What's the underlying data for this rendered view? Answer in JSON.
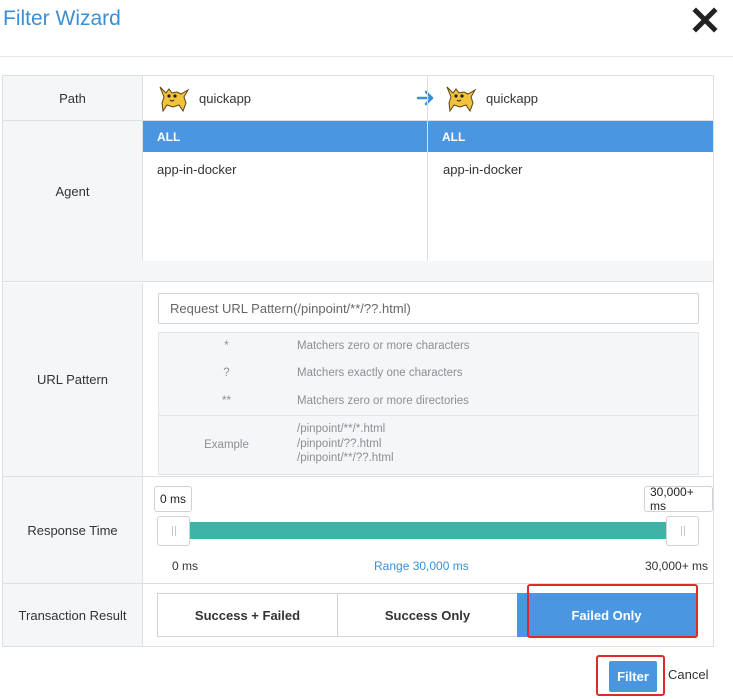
{
  "header": {
    "title": "Filter Wizard",
    "close_icon": "close-x-icon"
  },
  "path": {
    "label": "Path",
    "from_app": "quickapp",
    "to_app": "quickapp",
    "app_icon": "tomcat-icon",
    "arrow_icon": "arrow-right-icon",
    "arrow_color": "#3a8fd6"
  },
  "agent": {
    "label": "Agent",
    "from": {
      "header": "ALL",
      "items": [
        "app-in-docker"
      ]
    },
    "to": {
      "header": "ALL",
      "items": [
        "app-in-docker"
      ]
    }
  },
  "url_pattern": {
    "label": "URL Pattern",
    "placeholder": "Request URL Pattern(/pinpoint/**/??.html)",
    "value": "",
    "help": [
      {
        "symbol": "*",
        "desc": "Matchers zero or more characters"
      },
      {
        "symbol": "?",
        "desc": "Matchers exactly one characters"
      },
      {
        "symbol": "**",
        "desc": "Matchers zero or more directories"
      }
    ],
    "example": {
      "label": "Example",
      "lines": [
        "/pinpoint/**/*.html",
        "/pinpoint/??.html",
        "/pinpoint/**/??.html"
      ]
    }
  },
  "response_time": {
    "label": "Response Time",
    "min_tip": "0 ms",
    "max_tip": "30,000+ ms",
    "scale_min": "0 ms",
    "scale_range": "Range 30,000 ms",
    "scale_max": "30,000+ ms",
    "selected_min_fraction": 0.0,
    "selected_max_fraction": 1.0,
    "bar_color": "#3db4a5"
  },
  "transaction_result": {
    "label": "Transaction Result",
    "options": [
      "Success + Failed",
      "Success Only",
      "Failed Only"
    ],
    "selected": "Failed Only",
    "active_color": "#4a96e0"
  },
  "footer": {
    "filter_label": "Filter",
    "cancel_label": "Cancel"
  },
  "highlight_color": "#e0292b"
}
